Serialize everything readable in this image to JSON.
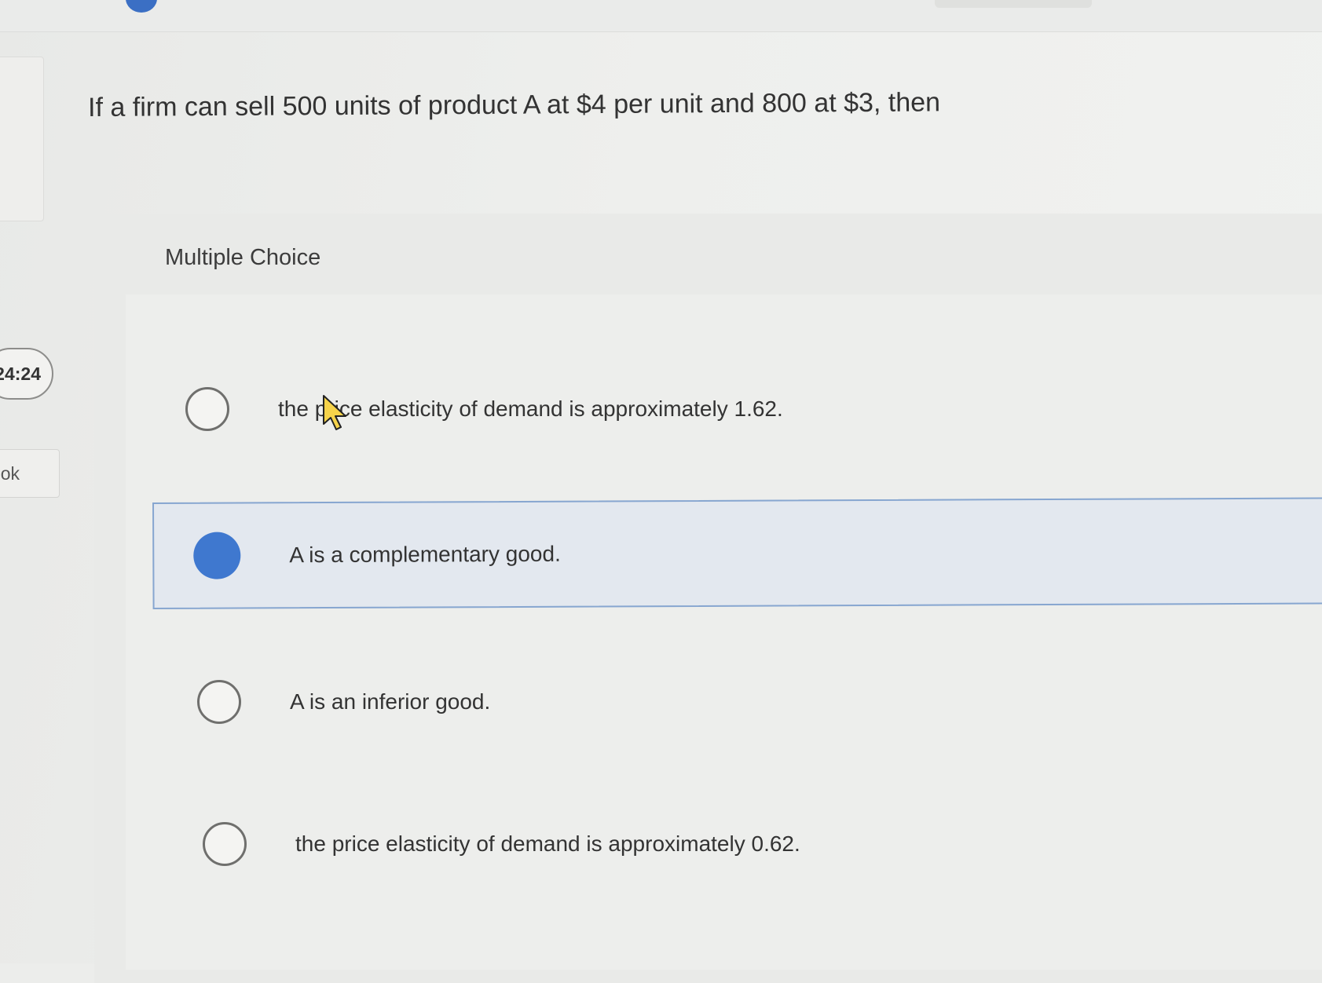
{
  "header": {
    "timer": "24:24",
    "book_label": "ok"
  },
  "question": {
    "text": "If a firm can sell 500 units of product A at $4 per unit and 800 at $3, then"
  },
  "choices": {
    "heading": "Multiple Choice",
    "selected_index": 1,
    "options": [
      {
        "label": "the price elasticity of demand is approximately 1.62.",
        "selected": false
      },
      {
        "label": "A is a complementary good.",
        "selected": true
      },
      {
        "label": "A is an inferior good.",
        "selected": false
      },
      {
        "label": "the price elasticity of demand is approximately 0.62.",
        "selected": false
      }
    ]
  },
  "colors": {
    "accent": "#3f78cf",
    "selected_border": "#87a6d0",
    "selected_background": "#e3e8ef"
  },
  "icons": {
    "cursor": "mouse-pointer-icon"
  }
}
